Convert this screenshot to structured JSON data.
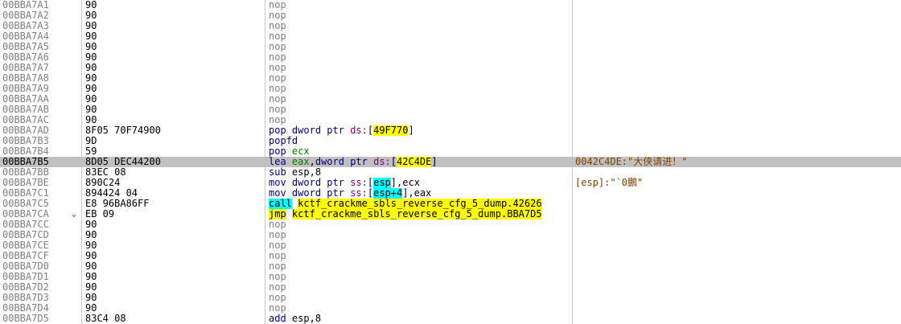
{
  "rows": [
    {
      "addr": "00BBA7A1",
      "bytes": "90",
      "mnem": "nop"
    },
    {
      "addr": "00BBA7A2",
      "bytes": "90",
      "mnem": "nop"
    },
    {
      "addr": "00BBA7A3",
      "bytes": "90",
      "mnem": "nop"
    },
    {
      "addr": "00BBA7A4",
      "bytes": "90",
      "mnem": "nop"
    },
    {
      "addr": "00BBA7A5",
      "bytes": "90",
      "mnem": "nop"
    },
    {
      "addr": "00BBA7A6",
      "bytes": "90",
      "mnem": "nop"
    },
    {
      "addr": "00BBA7A7",
      "bytes": "90",
      "mnem": "nop"
    },
    {
      "addr": "00BBA7A8",
      "bytes": "90",
      "mnem": "nop"
    },
    {
      "addr": "00BBA7A9",
      "bytes": "90",
      "mnem": "nop"
    },
    {
      "addr": "00BBA7AA",
      "bytes": "90",
      "mnem": "nop"
    },
    {
      "addr": "00BBA7AB",
      "bytes": "90",
      "mnem": "nop"
    },
    {
      "addr": "00BBA7AC",
      "bytes": "90",
      "mnem": "nop"
    },
    {
      "addr": "00BBA7AD",
      "bytes": "8F05 70F74900",
      "mnem": "pop",
      "sz": "dword ptr",
      "seg": "ds:",
      "pre": "",
      "target": "49F770",
      "post": "]",
      "open": "["
    },
    {
      "addr": "00BBA7B3",
      "bytes": "9D",
      "mnem": "popfd"
    },
    {
      "addr": "00BBA7B4",
      "bytes": "59",
      "mnem": "pop",
      "reg": "ecx"
    },
    {
      "addr": "00BBA7B5",
      "bytes": "8D05 DEC44200",
      "mnem": "lea",
      "reg": "eax",
      "sz": "dword ptr",
      "seg": "ds:",
      "open": "[",
      "target": "42C4DE",
      "post": "]",
      "comment": "0042C4DE:\"大侠请进！\"",
      "selected": true
    },
    {
      "addr": "00BBA7BB",
      "bytes": "83EC 08",
      "mnem": "sub",
      "plain": "esp,8"
    },
    {
      "addr": "00BBA7BE",
      "bytes": "890C24",
      "mnem": "mov",
      "sz": "dword ptr",
      "seg": "ss:",
      "open": "[",
      "regtarget": "esp",
      "post": "],ecx",
      "comment": "[esp]:\"`0鵬\""
    },
    {
      "addr": "00BBA7C1",
      "bytes": "894424 04",
      "mnem": "mov",
      "sz": "dword ptr",
      "seg": "ss:",
      "open": "[",
      "regtarget": "esp+4",
      "post": "],eax"
    },
    {
      "addr": "00BBA7C5",
      "bytes": "E8 96BA86FF",
      "mnem": "call",
      "call": "kctf_crackme_sbls_reverse_cfg_5_dump.42626"
    },
    {
      "addr": "00BBA7CA",
      "bytes": "EB 09",
      "mnem": "jmp",
      "call": "kctf_crackme_sbls_reverse_cfg_5_dump.BBA7D5",
      "arrow": "⌄"
    },
    {
      "addr": "00BBA7CC",
      "bytes": "90",
      "mnem": "nop"
    },
    {
      "addr": "00BBA7CD",
      "bytes": "90",
      "mnem": "nop"
    },
    {
      "addr": "00BBA7CE",
      "bytes": "90",
      "mnem": "nop"
    },
    {
      "addr": "00BBA7CF",
      "bytes": "90",
      "mnem": "nop"
    },
    {
      "addr": "00BBA7D0",
      "bytes": "90",
      "mnem": "nop"
    },
    {
      "addr": "00BBA7D1",
      "bytes": "90",
      "mnem": "nop"
    },
    {
      "addr": "00BBA7D2",
      "bytes": "90",
      "mnem": "nop"
    },
    {
      "addr": "00BBA7D3",
      "bytes": "90",
      "mnem": "nop"
    },
    {
      "addr": "00BBA7D4",
      "bytes": "90",
      "mnem": "nop"
    },
    {
      "addr": "00BBA7D5",
      "bytes": "83C4 08",
      "mnem": "add",
      "plain": "esp,8"
    }
  ]
}
